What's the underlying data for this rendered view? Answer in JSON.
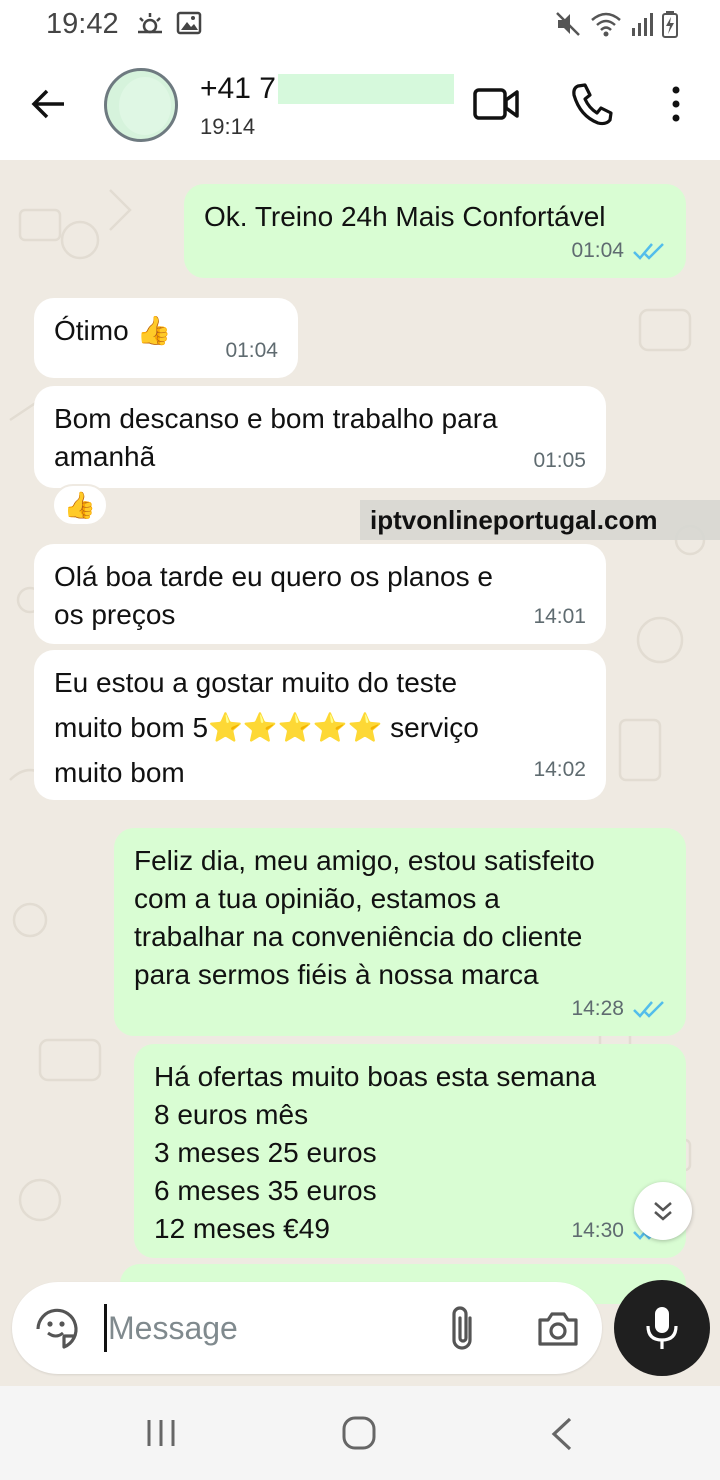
{
  "status_bar": {
    "time": "19:42",
    "left_icons": [
      "weather-icon",
      "image-icon"
    ],
    "right_icons": [
      "mute-icon",
      "wifi-icon",
      "signal-icon",
      "battery-icon"
    ]
  },
  "header": {
    "contact_name": "+41 7",
    "contact_status": "19:14"
  },
  "messages": [
    {
      "direction": "out",
      "text": "Ok. Treino 24h Mais Confortável",
      "time": "01:04",
      "read": true
    },
    {
      "direction": "in",
      "text": "Ótimo 👍",
      "time": "01:04"
    },
    {
      "direction": "in",
      "text": "Bom descanso e bom trabalho para\namanhã",
      "time": "01:05",
      "reaction": "👍"
    },
    {
      "direction": "in",
      "text": "Olá boa tarde eu quero os planos e\nos preços",
      "time": "14:01"
    },
    {
      "direction": "in",
      "text": "Eu estou a gostar muito do teste\nmuito bom 5⭐⭐⭐⭐⭐ serviço\nmuito bom",
      "time": "14:02"
    },
    {
      "direction": "out",
      "text": "Feliz dia, meu amigo, estou satisfeito\ncom a tua opinião, estamos a\ntrabalhar na conveniência do cliente\npara sermos fiéis à nossa marca",
      "time": "14:28",
      "read": true
    },
    {
      "direction": "out",
      "text": "Há ofertas muito boas esta semana\n8 euros mês\n3 meses 25 euros\n6 meses 35 euros\n12 meses €49",
      "time": "14:30",
      "read": true
    }
  ],
  "reaction_emoji": "👍",
  "watermark": "iptvonlineportugal.com",
  "composer": {
    "placeholder": "Message",
    "value": ""
  },
  "colors": {
    "chat_bg": "#efeae2",
    "incoming_bubble": "#ffffff",
    "outgoing_bubble": "#d9fdd3",
    "read_ticks": "#53bdeb",
    "mic_button": "#1f1f1f"
  }
}
